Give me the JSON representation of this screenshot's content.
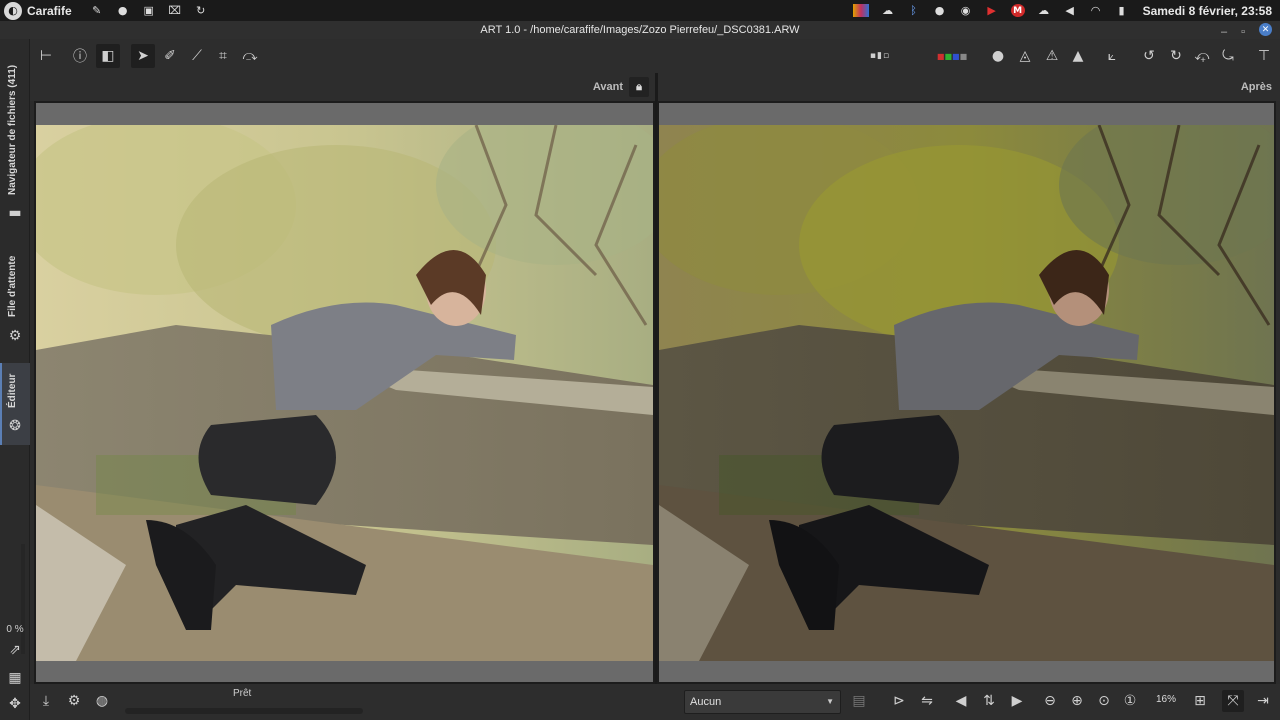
{
  "system_bar": {
    "app_name": "Carafife",
    "clock": "Samedi 8 février, 23:58",
    "tray_icons": [
      "color-icon",
      "weather-icon",
      "bluetooth-icon",
      "lightbulb-icon",
      "eye-icon",
      "media-icon",
      "mail-m-icon",
      "cloud-icon",
      "volume-icon",
      "wifi-icon",
      "battery-icon",
      "power-icon"
    ]
  },
  "window": {
    "title": "ART 1.0 - /home/carafife/Images/Zozo Pierrefeu/_DSC0381.ARW"
  },
  "left_tabs": {
    "file_browser": "Navigateur de fichiers (411)",
    "queue": "File d'attente",
    "editor": "Éditeur",
    "percent": "0 %"
  },
  "toolbar": {
    "icons": [
      "split-view-icon",
      "info-icon",
      "before-after-icon",
      "hand-select-icon",
      "color-picker-icon",
      "straighten-icon",
      "crop-icon",
      "transform-icon"
    ],
    "right_icons": [
      "swatch-icon",
      "preview-color-icon",
      "circle-icon",
      "focus-mask-icon",
      "warning-shadows-icon",
      "warning-highlights-icon",
      "histogram-icon",
      "rotate-left-icon",
      "rotate-right-icon",
      "flip-vertical-icon",
      "flip-horizontal-icon",
      "panel-toggle-icon"
    ]
  },
  "compare": {
    "before_label": "Avant",
    "after_label": "Après"
  },
  "bottom_bar": {
    "status": "Prêt",
    "profile_value": "Aucun",
    "zoom": "16%",
    "progress": 0
  },
  "colors": {
    "accent": "#5b7fb5",
    "background": "#2b2b2b"
  }
}
